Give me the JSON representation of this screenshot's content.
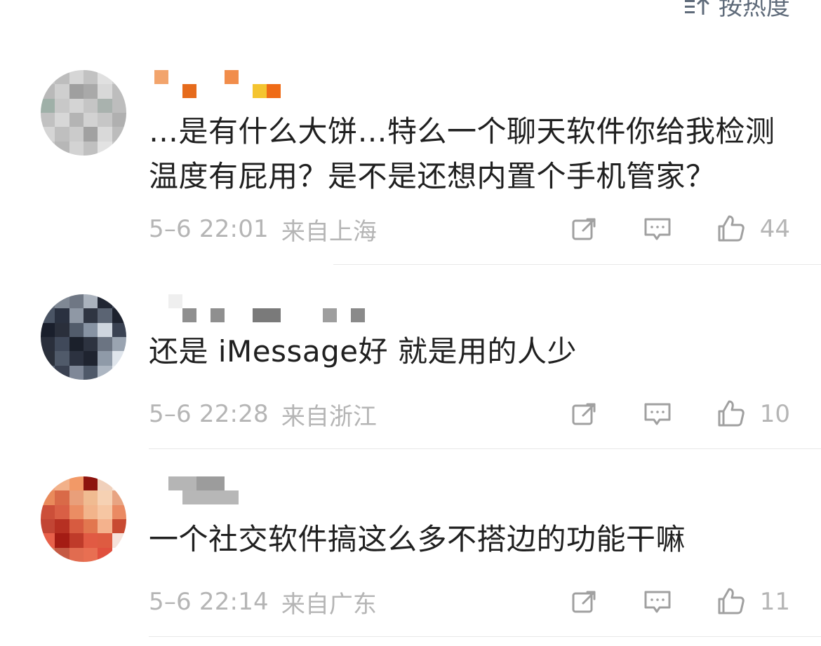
{
  "header": {
    "sort_label": "按热度"
  },
  "comments": [
    {
      "text": "…是有什么大饼…特么一个聊天软件你给我检测温度有屁用？是不是还想内置个手机管家？",
      "time": "5–6 22:01",
      "location": "来自上海",
      "likes": "44"
    },
    {
      "text": "还是 iMessage好 就是用的人少",
      "time": "5–6 22:28",
      "location": "来自浙江",
      "likes": "10"
    },
    {
      "text": "一个社交软件搞这么多不搭边的功能干嘛",
      "time": "5–6 22:14",
      "location": "来自广东",
      "likes": "11"
    }
  ],
  "icons": {
    "sort": "sort-icon",
    "share": "share-icon",
    "reply": "reply-icon",
    "like": "like-icon"
  },
  "colors": {
    "text": "#202020",
    "meta": "#b5b5b5",
    "icon": "#a0a0a0",
    "divider": "#e8e8e8"
  }
}
